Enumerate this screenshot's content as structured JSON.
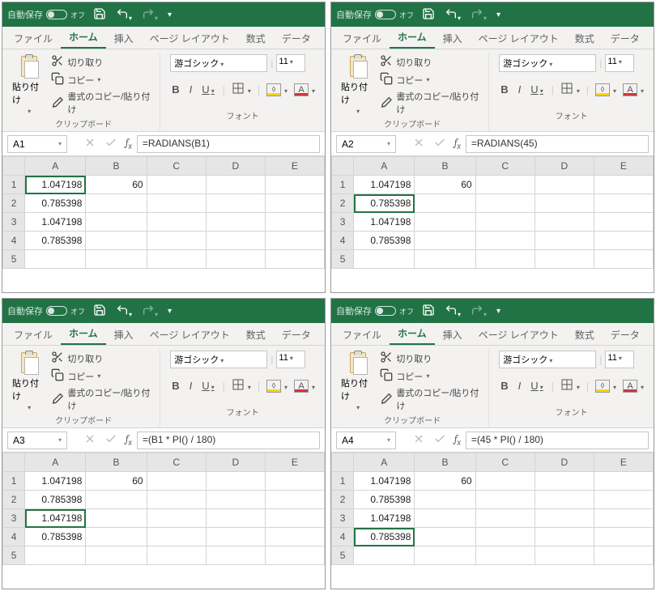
{
  "common": {
    "autosave_label": "自動保存",
    "autosave_state": "オフ",
    "tabs": [
      "ファイル",
      "ホーム",
      "挿入",
      "ページ レイアウト",
      "数式",
      "データ"
    ],
    "active_tab_index": 1,
    "clipboard": {
      "paste_label": "貼り付け",
      "cut_label": "切り取り",
      "copy_label": "コピー",
      "format_painter_label": "書式のコピー/貼り付け",
      "group_label": "クリップボード"
    },
    "font": {
      "font_name": "游ゴシック",
      "font_size": "11",
      "group_label": "フォント",
      "bold": "B",
      "italic": "I",
      "underline": "U",
      "fill_letter": "A",
      "color_letter": "A"
    },
    "columns": [
      "A",
      "B",
      "C",
      "D",
      "E"
    ],
    "row_numbers": [
      "1",
      "2",
      "3",
      "4",
      "5"
    ]
  },
  "panels": [
    {
      "name_box": "A1",
      "formula": "=RADIANS(B1)",
      "selected": {
        "row": 0,
        "col": 0
      },
      "cells": {
        "A": [
          "1.047198",
          "0.785398",
          "1.047198",
          "0.785398",
          ""
        ],
        "B": [
          "60",
          "",
          "",
          "",
          ""
        ]
      }
    },
    {
      "name_box": "A2",
      "formula": "=RADIANS(45)",
      "selected": {
        "row": 1,
        "col": 0
      },
      "cells": {
        "A": [
          "1.047198",
          "0.785398",
          "1.047198",
          "0.785398",
          ""
        ],
        "B": [
          "60",
          "",
          "",
          "",
          ""
        ]
      }
    },
    {
      "name_box": "A3",
      "formula": "=(B1 * PI() / 180)",
      "selected": {
        "row": 2,
        "col": 0
      },
      "cells": {
        "A": [
          "1.047198",
          "0.785398",
          "1.047198",
          "0.785398",
          ""
        ],
        "B": [
          "60",
          "",
          "",
          "",
          ""
        ]
      }
    },
    {
      "name_box": "A4",
      "formula": "=(45 * PI() / 180)",
      "selected": {
        "row": 3,
        "col": 0
      },
      "cells": {
        "A": [
          "1.047198",
          "0.785398",
          "1.047198",
          "0.785398",
          ""
        ],
        "B": [
          "60",
          "",
          "",
          "",
          ""
        ]
      }
    }
  ]
}
